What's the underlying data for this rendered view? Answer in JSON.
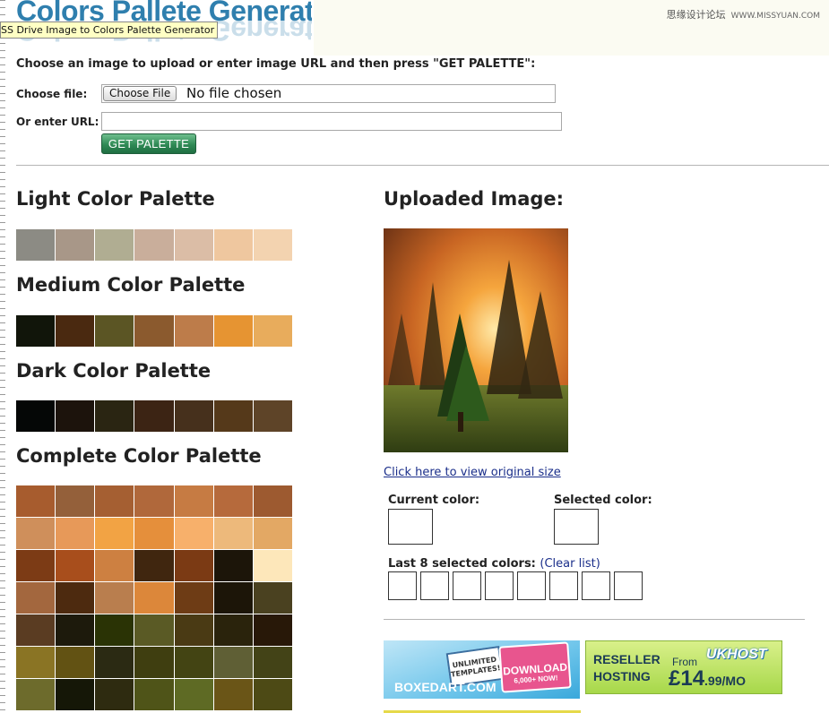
{
  "header": {
    "title": "Colors Pallete Generator",
    "tooltip": "SS Drive Image to Colors Palette Generator",
    "watermark": "思缘设计论坛",
    "watermark_url": "WWW.MISSYUAN.COM"
  },
  "form": {
    "instruction": "Choose an image to upload or enter image URL and then press \"GET PALETTE\":",
    "file_label": "Choose file:",
    "choose_file_button": "Choose File",
    "no_file_text": "No file chosen",
    "url_label": "Or enter URL:",
    "url_value": "",
    "get_palette_button": "GET PALETTE"
  },
  "palettes": {
    "light": {
      "title": "Light Color Palette",
      "colors": [
        "#8c8b84",
        "#a89788",
        "#b0ad92",
        "#c9ae9b",
        "#dbbda6",
        "#efc79f",
        "#f3d3b0"
      ]
    },
    "medium": {
      "title": "Medium Color Palette",
      "colors": [
        "#11150a",
        "#4a2910",
        "#5b5524",
        "#8b5a2e",
        "#bd7c4a",
        "#e69432",
        "#e8ac5c"
      ]
    },
    "dark": {
      "title": "Dark Color Palette",
      "colors": [
        "#050706",
        "#1c130c",
        "#2a2512",
        "#3c2414",
        "#46301c",
        "#55391a",
        "#5e4428"
      ]
    },
    "complete": {
      "title": "Complete Color Palette",
      "colors": [
        "#a75c2e",
        "#94603a",
        "#a55f32",
        "#b0683b",
        "#c67b43",
        "#b66a3c",
        "#9d5a30",
        "#cf8f5b",
        "#e79959",
        "#f2a344",
        "#e58f3b",
        "#f7b06b",
        "#edb97b",
        "#e3a864",
        "#7c3b15",
        "#a84e1c",
        "#cd8041",
        "#40260f",
        "#7b3a14",
        "#1c1509",
        "#fde7ba",
        "#a3673e",
        "#4d2a0f",
        "#b97e4e",
        "#dc873a",
        "#6e3c15",
        "#1c1508",
        "#4a4120",
        "#5a3c22",
        "#1d1a0c",
        "#2a3305",
        "#5a5a25",
        "#4a3a14",
        "#2a230c",
        "#281808",
        "#8a7424",
        "#625213",
        "#2b2a13",
        "#3f3e10",
        "#434413",
        "#5f5f35",
        "#434317",
        "#6d6b2c",
        "#151707",
        "#2e2b10",
        "#4f5418",
        "#5e6a24",
        "#6a5517",
        "#4d4a15"
      ]
    }
  },
  "uploaded": {
    "title": "Uploaded Image:",
    "view_link": "Click here to view original size",
    "current_color_label": "Current color:",
    "selected_color_label": "Selected color:",
    "last8_label": "Last 8 selected colors:",
    "clear_list": "(Clear list)"
  },
  "ads": {
    "boxedart": {
      "brand": "BOXEDART.COM",
      "tag_line1": "UNLIMITED",
      "tag_line2": "TEMPLATES!",
      "download": "DOWNLOAD",
      "download_sub": "6,000+ NOW!"
    },
    "ukhost": {
      "line1": "RESELLER",
      "line2": "HOSTING",
      "from": "From",
      "price": "£14",
      "price_cents": ".99",
      "per": "/MO",
      "logo": "UKHOST"
    }
  }
}
